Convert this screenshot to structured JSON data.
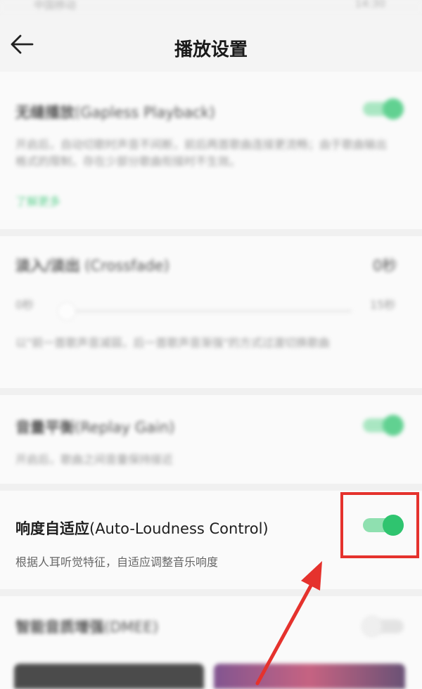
{
  "status_bar": {
    "left_text": "中国移动",
    "right_text": "14:30"
  },
  "header": {
    "title": "播放设置",
    "back_icon": "arrow-left-icon"
  },
  "sections": {
    "gapless": {
      "title_zh": "无缝播放",
      "title_en": "(Gapless Playback)",
      "desc": "开启后，自动切歌时声音不间断，前后两首歌曲连接更流畅；由于歌曲输出格式的限制，存在少部分歌曲衔接时不生效。",
      "link": "了解更多",
      "toggle_on": true
    },
    "crossfade": {
      "title_zh": "淡入/淡出",
      "title_en": " (Crossfade)",
      "value": "0秒",
      "min_label": "0秒",
      "max_label": "15秒",
      "desc": "以\"前一首歌声音减弱，后一首歌声音渐强\"的方式过渡切换歌曲",
      "slider_value": 0
    },
    "replay_gain": {
      "title_zh": "音量平衡",
      "title_en": "(Replay Gain)",
      "desc": "开启后，歌曲之间音量保持接近",
      "toggle_on": true
    },
    "auto_loudness": {
      "title_zh": "响度自适应",
      "title_en": "(Auto-Loudness Control)",
      "desc": "根据人耳听觉特征，自适应调整音乐响度",
      "toggle_on": true
    },
    "dmee": {
      "title_zh": "智能音质增强",
      "title_en": "(DMEE)",
      "toggle_on": false
    }
  },
  "colors": {
    "accent": "#2fc46f",
    "annotation": "#e5322d",
    "link": "#2fc46f"
  }
}
